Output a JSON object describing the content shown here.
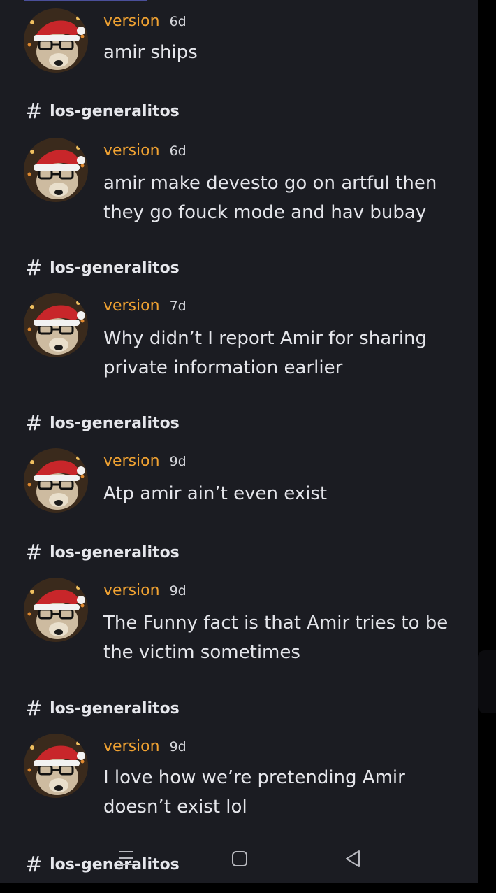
{
  "messages": [
    {
      "username": "version",
      "time": "6d",
      "text": "amir ships",
      "channel": "los-generalitos"
    },
    {
      "username": "version",
      "time": "6d",
      "text": "amir make devesto go on artful then they go fouck  mode and hav bubay",
      "channel": "los-generalitos"
    },
    {
      "username": "version",
      "time": "7d",
      "text": "Why didn’t I report Amir for sharing private information earlier",
      "channel": "los-generalitos"
    },
    {
      "username": "version",
      "time": "9d",
      "text": "Atp amir ain’t even exist",
      "channel": "los-generalitos"
    },
    {
      "username": "version",
      "time": "9d",
      "text": "The Funny fact is that Amir tries to be the victim sometimes",
      "channel": "los-generalitos"
    },
    {
      "username": "version",
      "time": "9d",
      "text": "I love how we’re pretending Amir doesn’t exist lol",
      "channel": "los-generalitos"
    }
  ],
  "channel_symbol": "#",
  "colors": {
    "background": "#1b1c22",
    "username": "#f0a232",
    "text": "#e4e5ea"
  },
  "nav_icons": [
    "menu-icon",
    "home-square-icon",
    "back-triangle-icon"
  ]
}
